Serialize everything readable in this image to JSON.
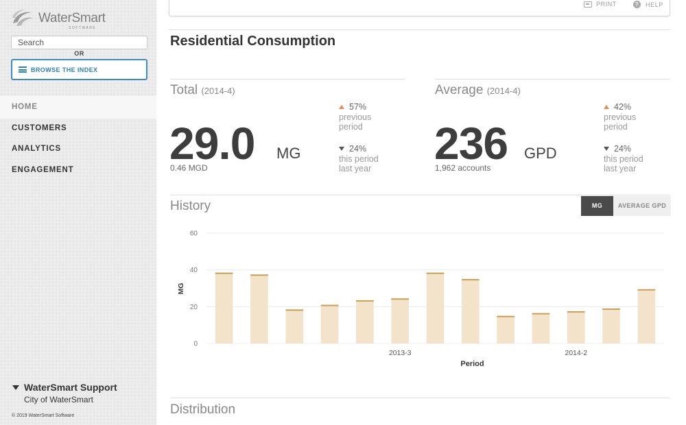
{
  "app": {
    "logo_text": "WaterSmart",
    "logo_sub": "SOFTWARE"
  },
  "sidebar": {
    "search_placeholder": "Search",
    "or_label": "OR",
    "browse_label": "BROWSE THE INDEX",
    "nav": [
      {
        "label": "HOME",
        "active": true
      },
      {
        "label": "CUSTOMERS"
      },
      {
        "label": "ANALYTICS"
      },
      {
        "label": "ENGAGEMENT"
      }
    ],
    "support_title": "WaterSmart Support",
    "support_org": "City of WaterSmart",
    "copyright": "© 2019 WaterSmart Software"
  },
  "toolbar": {
    "print": "PRINT",
    "help": "HELP"
  },
  "page_title": "Residential Consumption",
  "total": {
    "label": "Total",
    "period": "(2014-4)",
    "value": "29.0",
    "unit": "MG",
    "sub": "0.46 MGD",
    "change_prev_pct": "57%",
    "change_prev_label_1": "previous",
    "change_prev_label_2": "period",
    "change_year_pct": "24%",
    "change_year_label_1": "this period",
    "change_year_label_2": "last year"
  },
  "average": {
    "label": "Average",
    "period": "(2014-4)",
    "value": "236",
    "unit": "GPD",
    "sub": "1,962 accounts",
    "change_prev_pct": "42%",
    "change_prev_label_1": "previous",
    "change_prev_label_2": "period",
    "change_year_pct": "24%",
    "change_year_label_1": "this period",
    "change_year_label_2": "last year"
  },
  "history": {
    "title": "History",
    "toggle_mg": "MG",
    "toggle_gpd": "AVERAGE GPD"
  },
  "distribution": {
    "title": "Distribution"
  },
  "colors": {
    "bar_fill": "#f3e3cb",
    "bar_cap": "#c9a055",
    "up_arrow": "#f0884c",
    "accent_blue": "#2b7fb9"
  },
  "chart_data": {
    "type": "bar",
    "categories": [
      "",
      "",
      "",
      "",
      "",
      "2013-3",
      "",
      "",
      "",
      "",
      "2014-2",
      "",
      ""
    ],
    "values": [
      38.5,
      37.5,
      18.5,
      21,
      23.5,
      24.5,
      38.5,
      35,
      15,
      16.5,
      17.5,
      19,
      29.5
    ],
    "xlabel": "Period",
    "ylabel": "MG",
    "ylim": [
      0,
      60
    ],
    "yticks": [
      0,
      20,
      40,
      60
    ],
    "grid": true
  }
}
